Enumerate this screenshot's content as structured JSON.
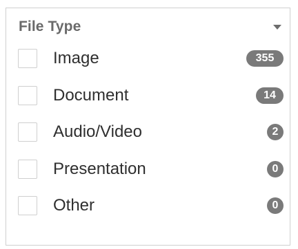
{
  "filter": {
    "title": "File Type",
    "toggle_icon": "chevron-down-icon",
    "items": [
      {
        "label": "Image",
        "count": "355"
      },
      {
        "label": "Document",
        "count": "14"
      },
      {
        "label": "Audio/Video",
        "count": "2"
      },
      {
        "label": "Presentation",
        "count": "0"
      },
      {
        "label": "Other",
        "count": "0"
      }
    ]
  }
}
